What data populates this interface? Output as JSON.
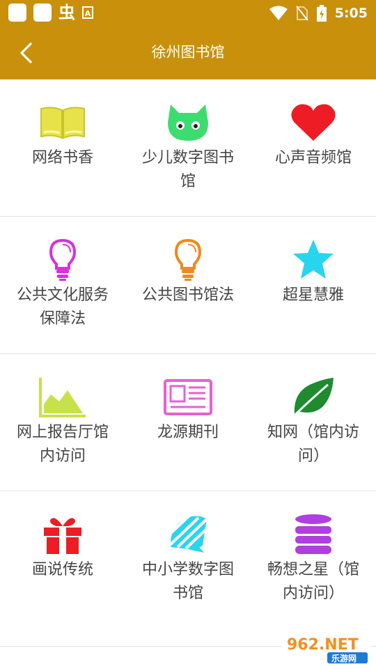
{
  "status_bar": {
    "time": "5:05",
    "left_glyph": "虫",
    "left_letter": "A"
  },
  "header": {
    "title": "徐州图书馆"
  },
  "colors": {
    "header_bg": "#c9900c",
    "label_text": "#444444",
    "divider": "#e2e2e2"
  },
  "grid": [
    [
      {
        "label": "网络书香",
        "icon": "open-book-icon",
        "color": "#e8e24a"
      },
      {
        "label": "少儿数字图书馆",
        "icon": "cat-face-icon",
        "color": "#3ddc6f"
      },
      {
        "label": "心声音频馆",
        "icon": "heart-icon",
        "color": "#ee1c24"
      }
    ],
    [
      {
        "label": "公共文化服务保障法",
        "icon": "lightbulb-icon",
        "color": "#d831d8"
      },
      {
        "label": "公共图书馆法",
        "icon": "lightbulb-icon",
        "color": "#f08a1a"
      },
      {
        "label": "超星慧雅",
        "icon": "star-icon",
        "color": "#29d5ee"
      }
    ],
    [
      {
        "label": "网上报告厅馆内访问",
        "icon": "area-chart-icon",
        "color": "#c6e24a"
      },
      {
        "label": "龙源期刊",
        "icon": "newspaper-icon",
        "color": "#e85fd6"
      },
      {
        "label": "知网（馆内访问）",
        "icon": "leaf-icon",
        "color": "#1e8c2e"
      }
    ],
    [
      {
        "label": "画说传统",
        "icon": "gift-icon",
        "color": "#ee1c24"
      },
      {
        "label": "中小学数字图书馆",
        "icon": "wifi-shape-icon",
        "color": "#29d5ee"
      },
      {
        "label": "畅想之星（馆内访问）",
        "icon": "database-icon",
        "color": "#b13ee0"
      }
    ]
  ],
  "watermark": {
    "brand": "962.NET",
    "sub": "乐游网"
  }
}
